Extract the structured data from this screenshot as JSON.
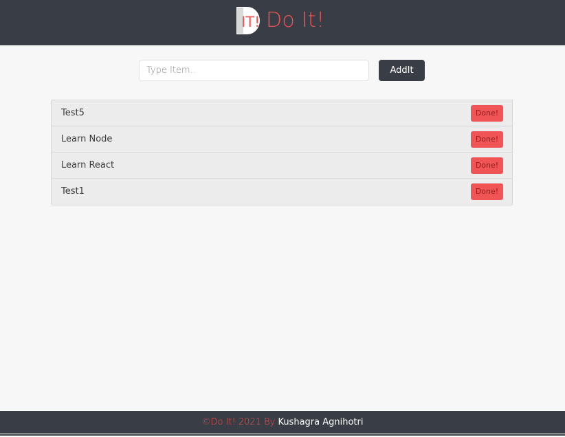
{
  "header": {
    "logo_text": "IT!",
    "title": "Do It!"
  },
  "add_form": {
    "placeholder": "Type Item..",
    "value": "",
    "button_label": "AddIt"
  },
  "tasks": [
    {
      "label": "Test5",
      "action_label": "Done!"
    },
    {
      "label": "Learn Node",
      "action_label": "Done!"
    },
    {
      "label": "Learn React",
      "action_label": "Done!"
    },
    {
      "label": "Test1",
      "action_label": "Done!"
    }
  ],
  "footer": {
    "prefix": "©Do It! 2021 By ",
    "author": "Kushagra Agnihotri"
  },
  "colors": {
    "header_bg": "#393e46",
    "accent": "#f05454",
    "page_bg": "#f7f7f7"
  }
}
